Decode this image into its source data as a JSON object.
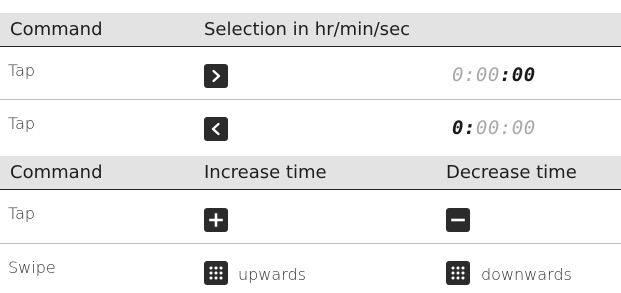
{
  "section1": {
    "header": {
      "command": "Command",
      "selection": "Selection in hr/min/sec"
    },
    "rows": [
      {
        "command": "Tap",
        "button_icon": "chevron-right-icon",
        "display": {
          "hour": "0",
          "sep1": ":",
          "min": "00",
          "sep2": ":",
          "sec": "00"
        },
        "highlighted": "seconds"
      },
      {
        "command": "Tap",
        "button_icon": "chevron-left-icon",
        "display": {
          "hour": "0",
          "sep1": ":",
          "min": "00",
          "sep2": ":",
          "sec": "00"
        },
        "highlighted": "hours"
      }
    ]
  },
  "section2": {
    "header": {
      "command": "Command",
      "increase": "Increase time",
      "decrease": "Decrease time"
    },
    "rows": [
      {
        "command": "Tap",
        "increase_icon": "plus-icon",
        "decrease_icon": "minus-icon"
      },
      {
        "command": "Swipe",
        "increase_icon": "grid-icon",
        "increase_text": "upwards",
        "decrease_icon": "grid-icon",
        "decrease_text": "downwards"
      }
    ]
  }
}
